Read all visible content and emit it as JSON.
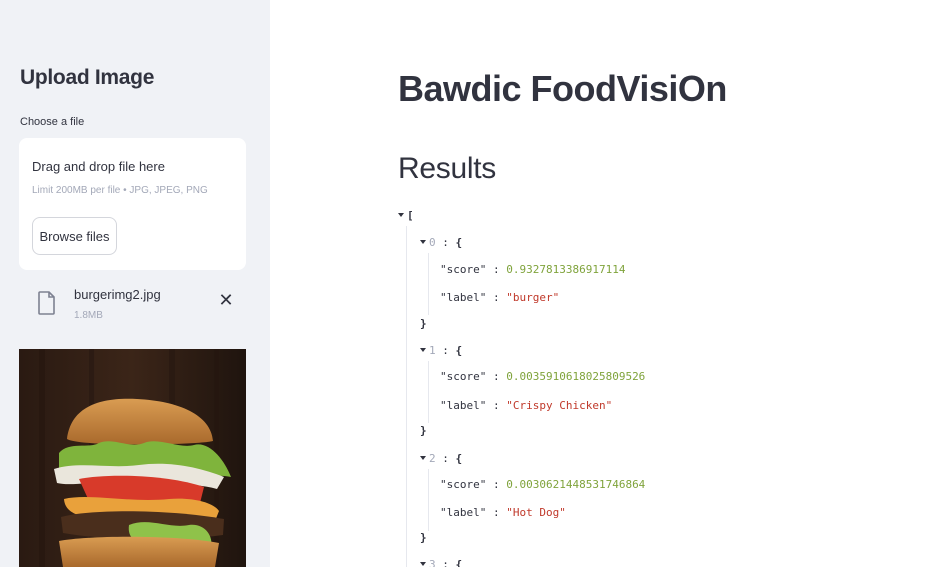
{
  "sidebar": {
    "title": "Upload Image",
    "choose_label": "Choose a file",
    "dropzone": {
      "title": "Drag and drop file here",
      "limit": "Limit 200MB per file • JPG, JPEG, PNG",
      "browse_label": "Browse files"
    },
    "file": {
      "name": "burgerimg2.jpg",
      "size": "1.8MB",
      "icon": "file-icon",
      "remove_icon": "close-icon",
      "remove_glyph": "✕"
    },
    "image_subject": "burger-photo"
  },
  "main": {
    "title": "Bawdic FoodVisiOn",
    "results_heading": "Results"
  },
  "json": {
    "open_bracket": "[",
    "items": [
      {
        "index": "0",
        "score": "0.9327813386917114",
        "label": "\"burger\""
      },
      {
        "index": "1",
        "score": "0.0035910618025809526",
        "label": "\"Crispy Chicken\""
      },
      {
        "index": "2",
        "score": "0.0030621448531746864",
        "label": "\"Hot Dog\""
      },
      {
        "index": "3"
      }
    ],
    "score_key": "\"score\"",
    "label_key": "\"label\"",
    "colon": ":",
    "open_brace": "{",
    "close_brace": "}"
  },
  "colors": {
    "sidebar_bg": "#f0f2f6",
    "number": "#7fa33b",
    "string": "#c0392b",
    "text": "#31333f"
  }
}
